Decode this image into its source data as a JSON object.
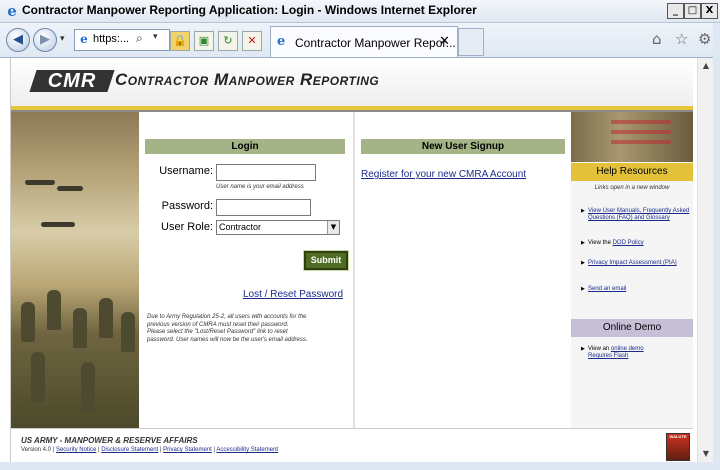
{
  "window": {
    "title": "Contractor Manpower Reporting Application: Login - Windows Internet Explorer",
    "min_label": "_",
    "max_label": "□",
    "close_label": "X"
  },
  "browser": {
    "back_glyph": "◀",
    "forward_glyph": "▶",
    "recent_glyph": "▾",
    "address_text": "https:...",
    "search_glyph": "⌕",
    "address_dropdown_glyph": "▾",
    "lock_glyph": "🔒",
    "compat_glyph": "▣",
    "refresh_glyph": "↻",
    "stop_glyph": "✕",
    "tab_label": "Contractor Manpower Repor...",
    "tab_close": "✕",
    "home_glyph": "⌂",
    "favorites_glyph": "☆",
    "tools_glyph": "⚙"
  },
  "banner": {
    "logo_text": "CMR",
    "title": "Contractor Manpower Reporting"
  },
  "login": {
    "header": "Login",
    "username_label": "Username:",
    "username_value": "",
    "username_hint": "User name is your email address",
    "password_label": "Password:",
    "password_value": "",
    "role_label": "User Role:",
    "role_value": "Contractor",
    "submit_label": "Submit",
    "lost_reset_link": "Lost / Reset Password",
    "note_lines": [
      "Due to Army Regulation 25-2, all users with accounts for the",
      "previous version of CMRA must reset their password.",
      "Please select the \"Lost/Reset Password\" link to reset",
      "password. User names will now be the user's email address."
    ]
  },
  "signup": {
    "header": "New User Signup",
    "register_link": "Register for your new CMRA Account"
  },
  "help": {
    "header": "Help Resources",
    "subtitle": "Links open in a new window",
    "items": [
      {
        "prefix": "",
        "link": "View User Manuals, Frequently Asked Questions (FAQ) and Glossary",
        "suffix": ""
      },
      {
        "prefix": "View the ",
        "link": "DOD Policy",
        "suffix": ""
      },
      {
        "prefix": "",
        "link": "Privacy Impact Assessment (PIA)",
        "suffix": ""
      },
      {
        "prefix": "",
        "link": "Send an email",
        "suffix": ""
      }
    ],
    "demo_header": "Online Demo",
    "demo_prefix": "View an ",
    "demo_link": "online demo",
    "demo_link2": "Requires Flash"
  },
  "footer": {
    "title": "US ARMY - MANPOWER & RESERVE AFFAIRS",
    "version": "Version 4.0",
    "links": [
      "Security Notice",
      "Disclosure Statement",
      "Privacy Statement",
      "Accessibility Statement"
    ],
    "logo_text": "ISALUTE"
  },
  "icons": {
    "ie": "ie-logo-icon",
    "colors": {
      "olive_header": "#a4b486",
      "gold": "#e3c23a",
      "purple": "#c7bfd6",
      "link": "#1a2c8a"
    }
  }
}
